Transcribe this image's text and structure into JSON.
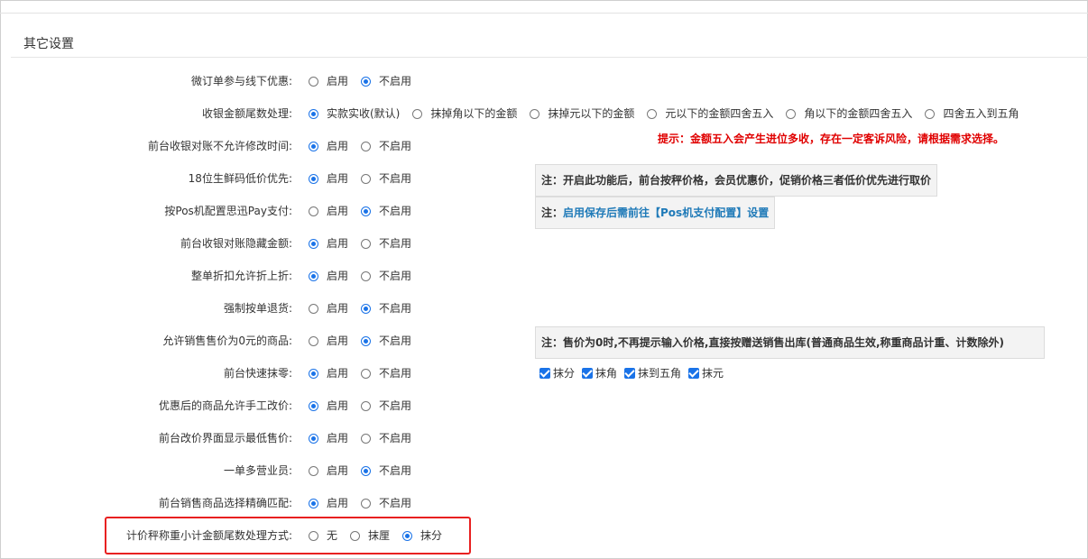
{
  "section_title": "其它设置",
  "rows": [
    {
      "label": "微订单参与线下优惠:",
      "options": [
        {
          "label": "启用",
          "checked": false
        },
        {
          "label": "不启用",
          "checked": true
        }
      ]
    },
    {
      "label": "收银金额尾数处理:",
      "options": [
        {
          "label": "实款实收(默认)",
          "checked": true
        },
        {
          "label": "抹掉角以下的金额",
          "checked": false
        },
        {
          "label": "抹掉元以下的金额",
          "checked": false
        },
        {
          "label": "元以下的金额四舍五入",
          "checked": false
        },
        {
          "label": "角以下的金额四舍五入",
          "checked": false
        },
        {
          "label": "四舍五入到五角",
          "checked": false
        }
      ]
    },
    {
      "label": "前台收银对账不允许修改时间:",
      "options": [
        {
          "label": "启用",
          "checked": true
        },
        {
          "label": "不启用",
          "checked": false
        }
      ]
    },
    {
      "label": "18位生鲜码低价优先:",
      "options": [
        {
          "label": "启用",
          "checked": true
        },
        {
          "label": "不启用",
          "checked": false
        }
      ]
    },
    {
      "label": "按Pos机配置思迅Pay支付:",
      "options": [
        {
          "label": "启用",
          "checked": false
        },
        {
          "label": "不启用",
          "checked": true
        }
      ]
    },
    {
      "label": "前台收银对账隐藏金额:",
      "options": [
        {
          "label": "启用",
          "checked": true
        },
        {
          "label": "不启用",
          "checked": false
        }
      ]
    },
    {
      "label": "整单折扣允许折上折:",
      "options": [
        {
          "label": "启用",
          "checked": true
        },
        {
          "label": "不启用",
          "checked": false
        }
      ]
    },
    {
      "label": "强制按单退货:",
      "options": [
        {
          "label": "启用",
          "checked": false
        },
        {
          "label": "不启用",
          "checked": true
        }
      ]
    },
    {
      "label": "允许销售售价为0元的商品:",
      "options": [
        {
          "label": "启用",
          "checked": false
        },
        {
          "label": "不启用",
          "checked": true
        }
      ]
    },
    {
      "label": "前台快速抹零:",
      "options": [
        {
          "label": "启用",
          "checked": true
        },
        {
          "label": "不启用",
          "checked": false
        }
      ]
    },
    {
      "label": "优惠后的商品允许手工改价:",
      "options": [
        {
          "label": "启用",
          "checked": true
        },
        {
          "label": "不启用",
          "checked": false
        }
      ]
    },
    {
      "label": "前台改价界面显示最低售价:",
      "options": [
        {
          "label": "启用",
          "checked": true
        },
        {
          "label": "不启用",
          "checked": false
        }
      ]
    },
    {
      "label": "一单多营业员:",
      "options": [
        {
          "label": "启用",
          "checked": false
        },
        {
          "label": "不启用",
          "checked": true
        }
      ]
    },
    {
      "label": "前台销售商品选择精确匹配:",
      "options": [
        {
          "label": "启用",
          "checked": true
        },
        {
          "label": "不启用",
          "checked": false
        }
      ]
    },
    {
      "label": "计价秤称重小计金额尾数处理方式:",
      "options": [
        {
          "label": "无",
          "checked": false
        },
        {
          "label": "抹厘",
          "checked": false
        },
        {
          "label": "抹分",
          "checked": true
        }
      ]
    }
  ],
  "hint_rounding": "提示：金额五入会产生进位多收，存在一定客诉风险，请根据需求选择。",
  "note_fresh": "注：开启此功能后，前台按秤价格，会员优惠价，促销价格三者低价优先进行取价",
  "note_pos_prefix": "注：",
  "note_pos_link": "启用保存后需前往【Pos机支付配置】设置",
  "note_zero": "注：售价为0时,不再提示输入价格,直接按赠送销售出库(普通商品生效,称重商品计重、计数除外)",
  "quick_zero_checks": [
    {
      "label": "抹分",
      "checked": true
    },
    {
      "label": "抹角",
      "checked": true
    },
    {
      "label": "抹到五角",
      "checked": true
    },
    {
      "label": "抹元",
      "checked": true
    }
  ],
  "colors": {
    "accent": "#1a73e8",
    "warning": "#e00000",
    "highlight": "#e82020",
    "link": "#1f7ab8"
  }
}
